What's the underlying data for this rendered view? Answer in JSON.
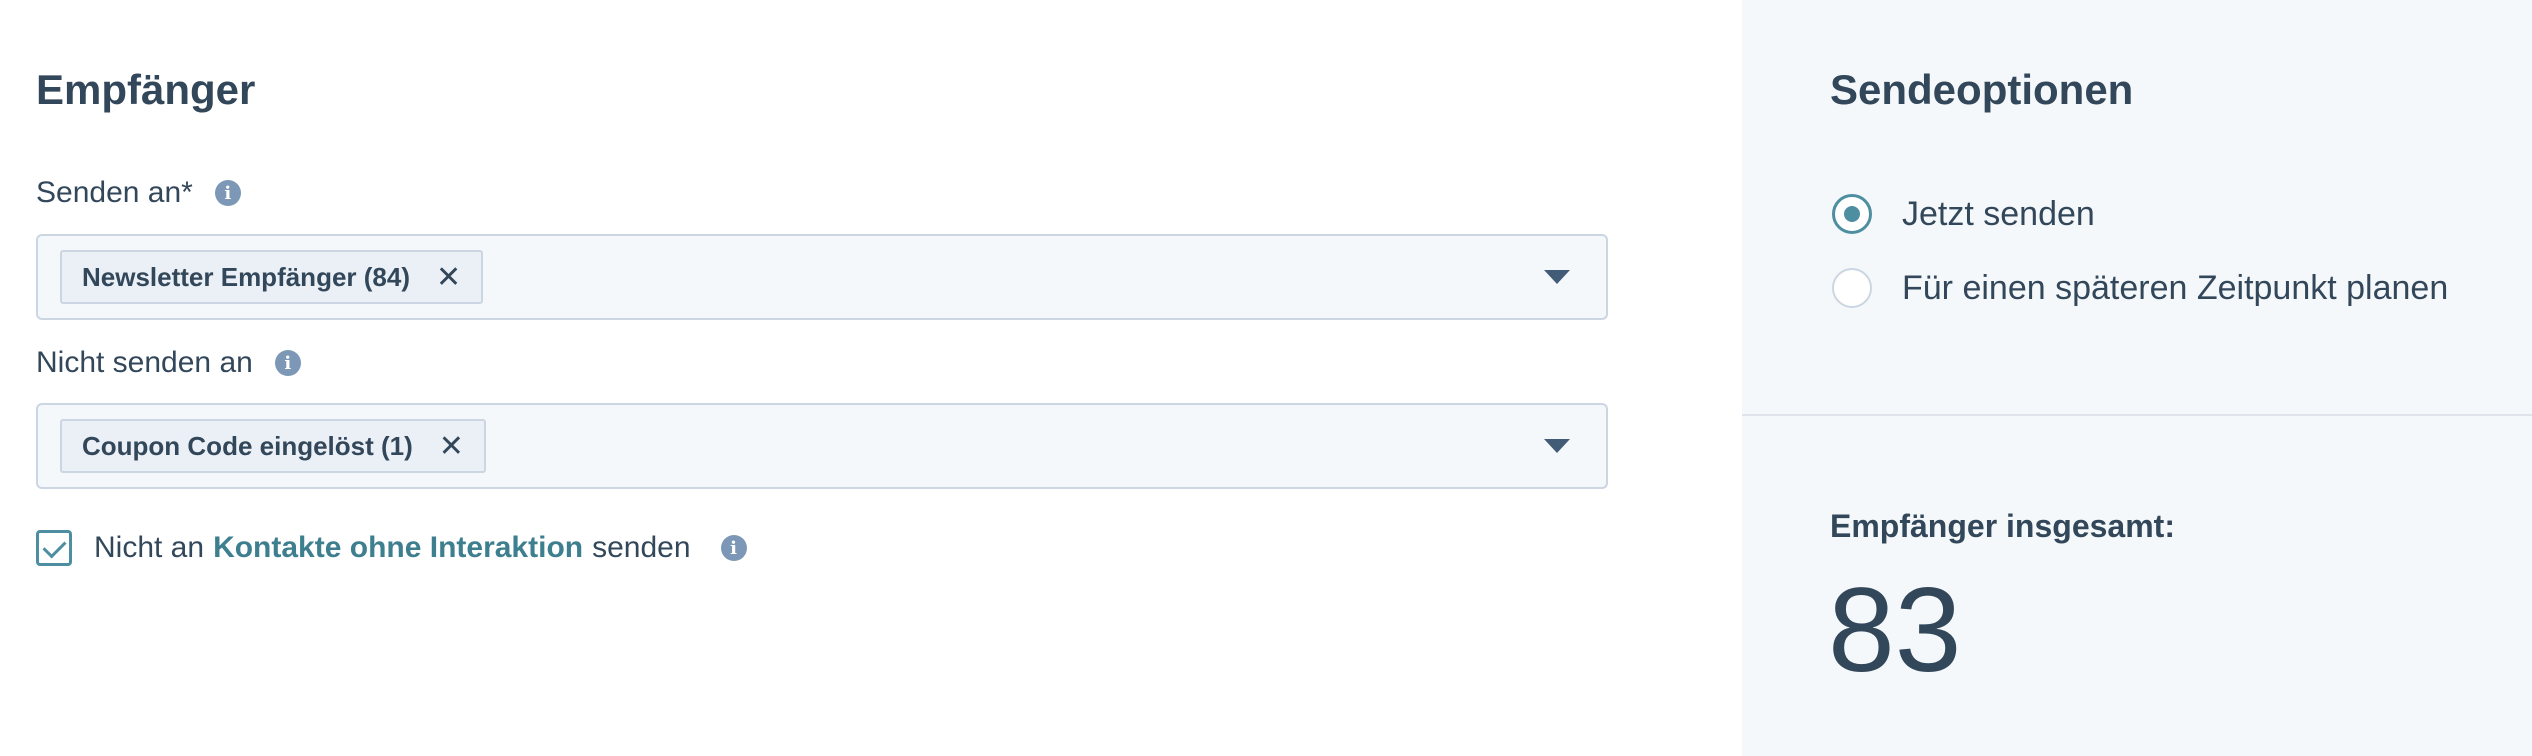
{
  "recipients": {
    "title": "Empfänger",
    "send_to": {
      "label": "Senden an*",
      "tag": "Newsletter Empfänger (84)"
    },
    "do_not_send_to": {
      "label": "Nicht senden an",
      "tag": "Coupon Code eingelöst (1)"
    },
    "checkbox": {
      "checked": true,
      "prefix": "Nicht an",
      "link": "Kontakte ohne Interaktion",
      "suffix": "senden"
    }
  },
  "send_options": {
    "title": "Sendeoptionen",
    "options": [
      {
        "label": "Jetzt senden",
        "selected": true
      },
      {
        "label": "Für einen späteren Zeitpunkt planen",
        "selected": false
      }
    ],
    "total_label": "Empfänger insgesamt:",
    "total_value": "83"
  },
  "icons": {
    "info": "info-icon",
    "remove": "close-icon",
    "dropdown": "caret-down-icon"
  },
  "colors": {
    "accent": "#4d8fa0",
    "link": "#3e7f8f",
    "text": "#33475b",
    "panel_bg": "#f5f8fa"
  }
}
